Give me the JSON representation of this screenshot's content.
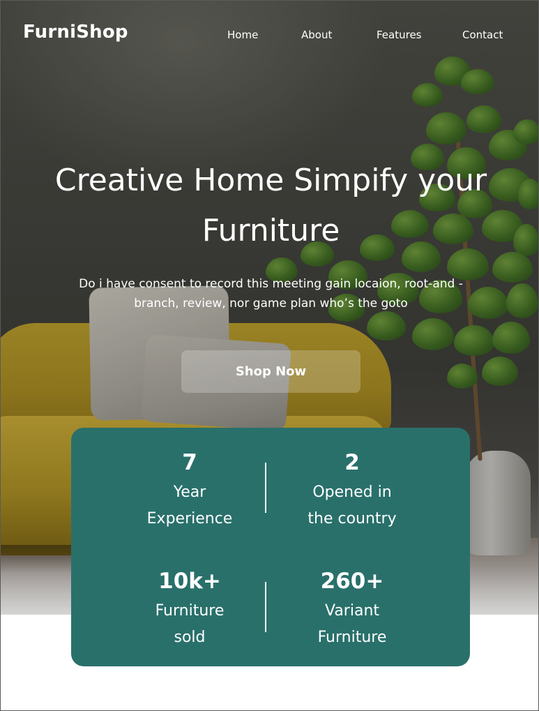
{
  "brand": {
    "logo": "FurniShop"
  },
  "nav": {
    "items": [
      {
        "label": "Home"
      },
      {
        "label": "About"
      },
      {
        "label": "Features"
      },
      {
        "label": "Contact"
      }
    ]
  },
  "hero": {
    "headline": "Creative Home Simpify your Furniture",
    "subtext": "Do i have consent to record this meeting gain locaion, root-and -branch, review, nor game plan who’s the goto",
    "cta_label": "Shop Now"
  },
  "stats": [
    {
      "value": "7",
      "label_line1": "Year",
      "label_line2": "Experience"
    },
    {
      "value": "2",
      "label_line1": "Opened in",
      "label_line2": "the country"
    },
    {
      "value": "10k+",
      "label_line1": "Furniture",
      "label_line2": "sold"
    },
    {
      "value": "260+",
      "label_line1": "Variant",
      "label_line2": "Furniture"
    }
  ],
  "colors": {
    "stats_card": "#29706b",
    "text": "#ffffff"
  }
}
